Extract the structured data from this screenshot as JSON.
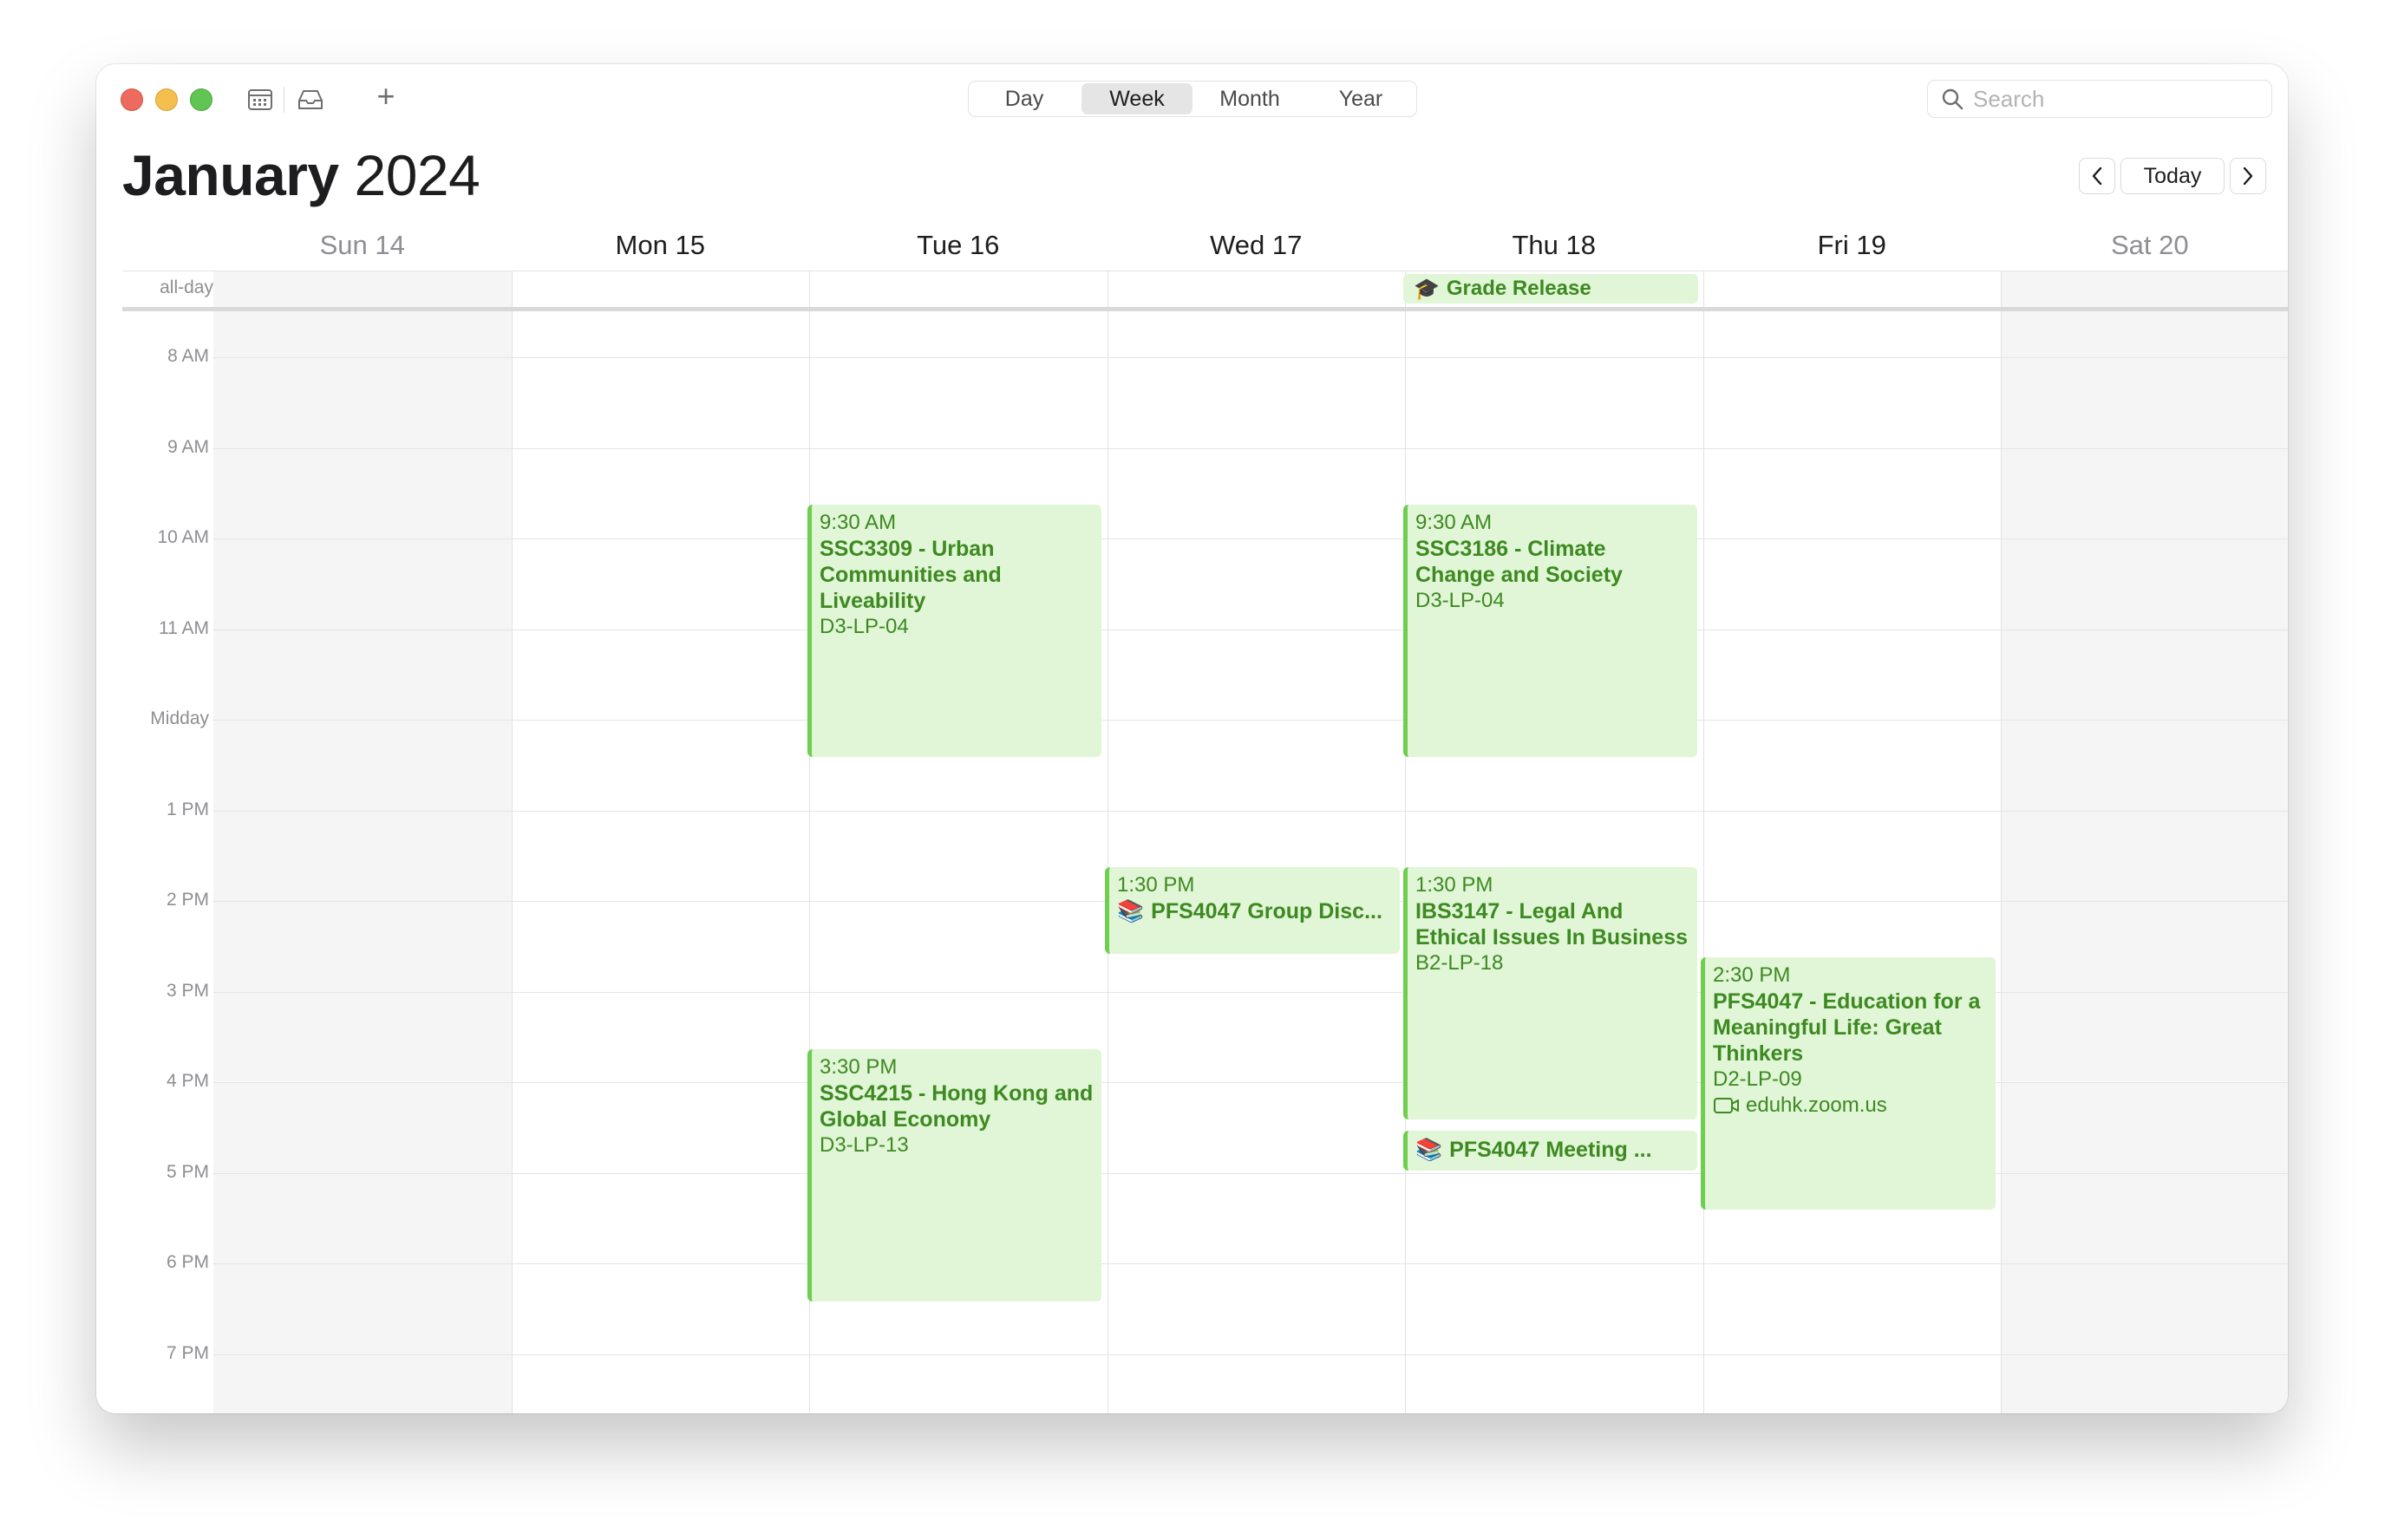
{
  "toolbar": {
    "views": [
      "Day",
      "Week",
      "Month",
      "Year"
    ],
    "active_view": "Week",
    "search_placeholder": "Search",
    "add_label": "+"
  },
  "header": {
    "month": "January",
    "year": "2024",
    "today_label": "Today"
  },
  "days": [
    {
      "label": "Sun 14",
      "weekend": true
    },
    {
      "label": "Mon 15",
      "weekend": false
    },
    {
      "label": "Tue 16",
      "weekend": false
    },
    {
      "label": "Wed 17",
      "weekend": false
    },
    {
      "label": "Thu 18",
      "weekend": false
    },
    {
      "label": "Fri 19",
      "weekend": false
    },
    {
      "label": "Sat 20",
      "weekend": true
    }
  ],
  "all_day": {
    "label": "all-day",
    "events": [
      {
        "day": "Thu 18",
        "emoji": "🎓",
        "title": "Grade Release"
      }
    ]
  },
  "hours": [
    "8 AM",
    "9 AM",
    "10 AM",
    "11 AM",
    "Midday",
    "1 PM",
    "2 PM",
    "3 PM",
    "4 PM",
    "5 PM",
    "6 PM",
    "7 PM"
  ],
  "events": [
    {
      "id": "tue1",
      "day": "Tue 16",
      "time": "9:30 AM",
      "title": "SSC3309 - Urban Communities and Liveability",
      "location": "D3-LP-04"
    },
    {
      "id": "thu1",
      "day": "Thu 18",
      "time": "9:30 AM",
      "title": "SSC3186 - Climate Change and Society",
      "location": "D3-LP-04"
    },
    {
      "id": "wed1",
      "day": "Wed 17",
      "time": "1:30 PM",
      "emoji": "📚",
      "title": "PFS4047 Group Disc..."
    },
    {
      "id": "thu2",
      "day": "Thu 18",
      "time": "1:30 PM",
      "title": "IBS3147 - Legal And Ethical Issues In Business",
      "location": "B2-LP-18"
    },
    {
      "id": "thu3",
      "day": "Thu 18",
      "emoji": "📚",
      "title": "PFS4047 Meeting ..."
    },
    {
      "id": "fri1",
      "day": "Fri 19",
      "time": "2:30 PM",
      "title": "PFS4047 - Education for a Meaningful Life: Great Thinkers",
      "location": "D2-LP-09",
      "url": "eduhk.zoom.us"
    },
    {
      "id": "tue2",
      "day": "Tue 16",
      "time": "3:30 PM",
      "title": "SSC4215 - Hong Kong and Global Economy",
      "location": "D3-LP-13"
    }
  ],
  "colors": {
    "event_bg": "#e1f5d7",
    "event_border": "#6dcf4d",
    "event_text": "#3d8a21"
  }
}
